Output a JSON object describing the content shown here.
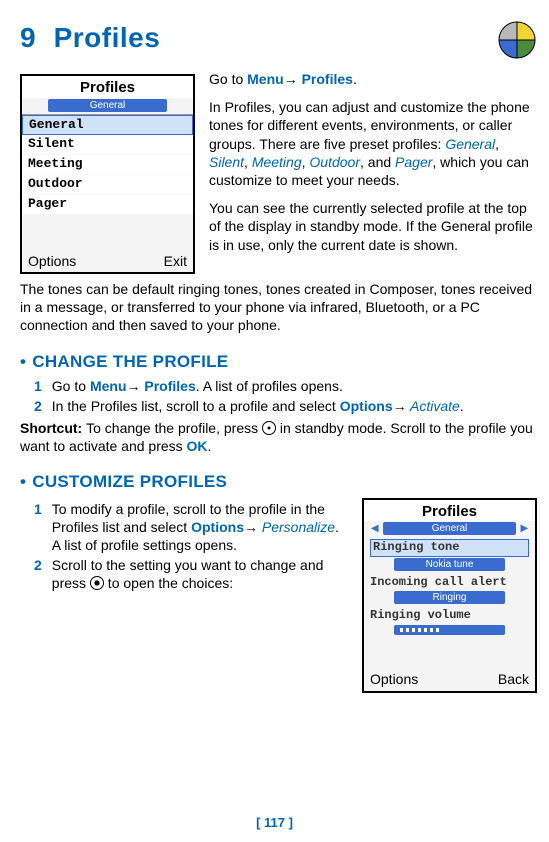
{
  "chapter": {
    "num": "9",
    "title": "Profiles"
  },
  "intro": {
    "goto_pre": "Go to ",
    "goto_menu": "Menu",
    "arrow": "→",
    "goto_profiles": " Profiles",
    "period": ".",
    "p1_a": "In Profiles, you can adjust and customize the phone tones for different events, environments, or caller groups. There are five preset profiles: ",
    "gen": "General",
    "sil": "Silent",
    "mee": "Meeting",
    "out": "Outdoor",
    "pag": "Pager",
    "c": ", ",
    "and": ", and ",
    "p1_b": ", which you can customize to meet your needs.",
    "p2": "You can see the currently selected profile at the top of the display in standby mode. If the General profile is in use, only the current date is shown.",
    "p3": "The tones can be default ringing tones, tones created in Composer, tones received in a message, or transferred to your phone via infrared, Bluetooth, or a PC connection and then saved to your phone."
  },
  "screen1": {
    "title": "Profiles",
    "sub": "General",
    "items": [
      "General",
      "Silent",
      "Meeting",
      "Outdoor",
      "Pager"
    ],
    "left": "Options",
    "right": "Exit"
  },
  "change": {
    "heading": "CHANGE THE PROFILE",
    "s1_pre": "Go to ",
    "s1_menu": "Menu",
    "s1_arrow": "→",
    "s1_prof": " Profiles",
    "s1_post": ". A list of profiles opens.",
    "s2_pre": "In the Profiles list, scroll to a profile and select ",
    "s2_opt": "Options",
    "s2_arrow": "→",
    "s2_act": " Activate",
    "s2_post": ".",
    "sc_label": "Shortcut: ",
    "sc_a": "To change the profile, press ",
    "sc_b": " in standby mode. Scroll to the profile you want to activate and press ",
    "sc_ok": "OK",
    "sc_c": "."
  },
  "customize": {
    "heading": "CUSTOMIZE PROFILES",
    "s1_a": "To modify a profile, scroll to the profile in the Profiles list and select ",
    "s1_opt": "Options",
    "s1_arrow": "→",
    "s1_pers": " Personalize",
    "s1_b": ". A list of profile settings opens.",
    "s2_a": "Scroll to the setting you want to change and press ",
    "s2_b": " to open the choices:"
  },
  "screen2": {
    "title": "Profiles",
    "sub": "General",
    "f1_label": "Ringing tone",
    "f1_val": "Nokia tune",
    "f2_label": "Incoming call alert",
    "f2_val": "Ringing",
    "f3_label": "Ringing volume",
    "left": "Options",
    "right": "Back"
  },
  "page": "[ 117 ]",
  "numbers": {
    "one": "1",
    "two": "2"
  }
}
